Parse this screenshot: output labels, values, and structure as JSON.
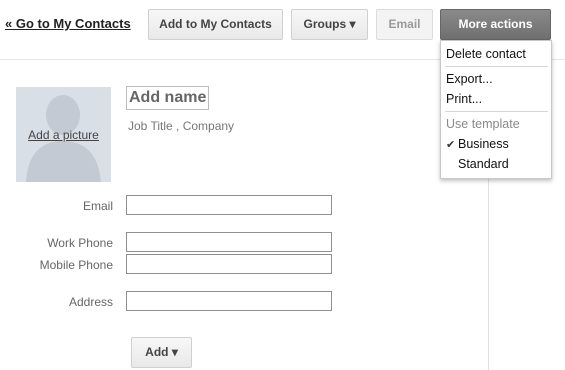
{
  "header": {
    "back_link": "« Go to My Contacts",
    "add_to_contacts": "Add to My Contacts",
    "groups": "Groups ▾",
    "email": "Email",
    "more_actions": "More actions"
  },
  "contact": {
    "name_placeholder": "Add name",
    "job_line": "Job Title ,  Company",
    "add_picture": "Add a picture"
  },
  "fields": {
    "email": "Email",
    "work_phone": "Work Phone",
    "mobile_phone": "Mobile Phone",
    "address": "Address"
  },
  "add_button": "Add ▾",
  "more_actions_menu": {
    "delete": "Delete contact",
    "export": "Export...",
    "print": "Print...",
    "use_template": "Use template",
    "business": "Business",
    "standard": "Standard",
    "check": "✔"
  }
}
